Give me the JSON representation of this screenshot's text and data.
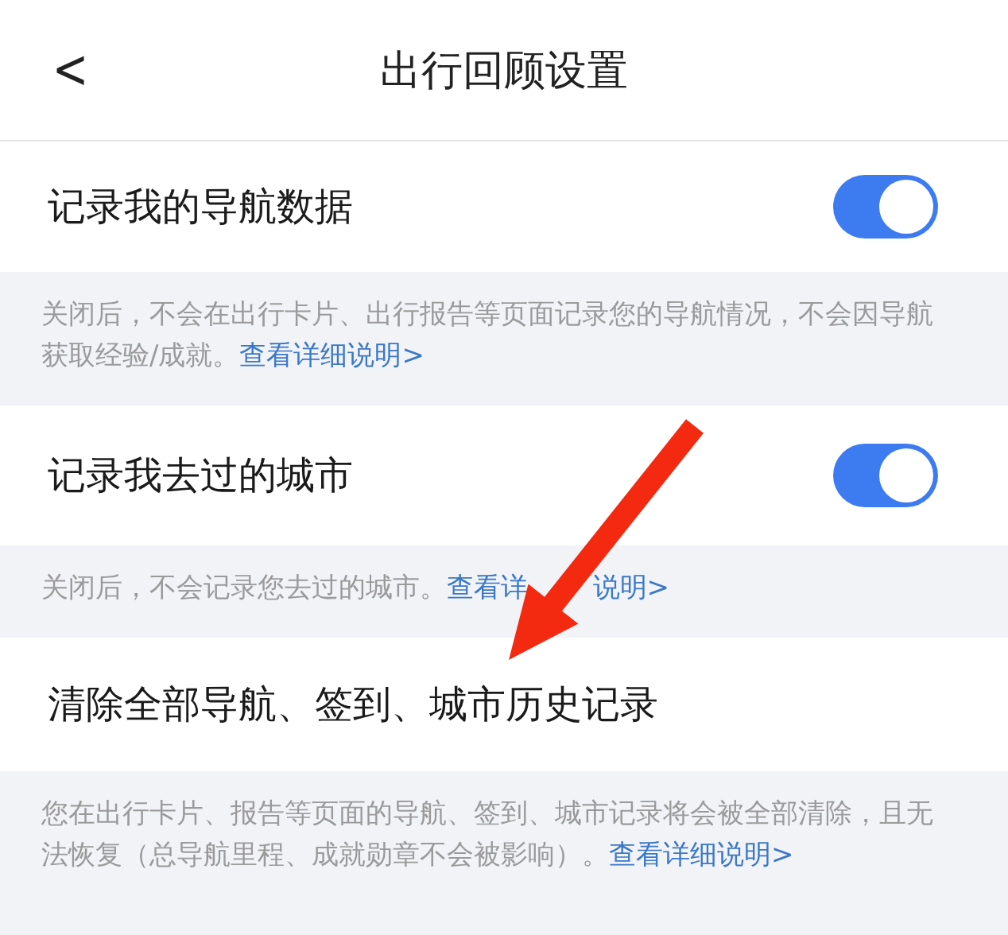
{
  "header": {
    "back": "<",
    "title": "出行回顾设置"
  },
  "sections": [
    {
      "kind": "toggle",
      "label": "记录我的导航数据",
      "on": true,
      "description": "关闭后，不会在出行卡片、出行报告等页面记录您的导航情况，不会因导航获取经验/成就。",
      "link": "查看详细说明>"
    },
    {
      "kind": "toggle",
      "label": "记录我去过的城市",
      "on": true,
      "description": "关闭后，不会记录您去过的城市。",
      "link": "查看详",
      "link_after_cover": "说明>"
    },
    {
      "kind": "action",
      "label": "清除全部导航、签到、城市历史记录",
      "description": "您在出行卡片、报告等页面的导航、签到、城市记录将会被全部清除，且无法恢复（总导航里程、成就勋章不会被影响）。",
      "link": "查看详细说明>"
    }
  ]
}
